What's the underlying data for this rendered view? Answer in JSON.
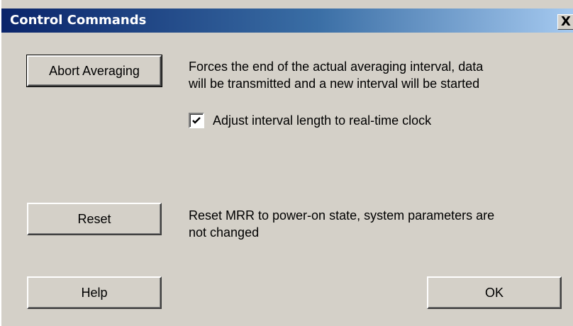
{
  "window": {
    "title": "Control Commands",
    "close_glyph": "X",
    "close_icon": "close-icon"
  },
  "abort": {
    "button_label": "Abort Averaging",
    "description_line1": "Forces the end of the actual averaging interval, data",
    "description_line2": "will be transmitted and a new interval will be started"
  },
  "adjust_clock": {
    "label": "Adjust interval length to real-time clock",
    "checked": true
  },
  "reset": {
    "button_label": "Reset",
    "description_line1": "Reset MRR to power-on state, system parameters are",
    "description_line2": "not changed"
  },
  "footer": {
    "help_label": "Help",
    "ok_label": "OK"
  },
  "colors": {
    "dialog_background": "#d4d0c8",
    "titlebar_start": "#0a246a",
    "titlebar_end": "#a6caf0",
    "title_text": "#ffffff"
  }
}
